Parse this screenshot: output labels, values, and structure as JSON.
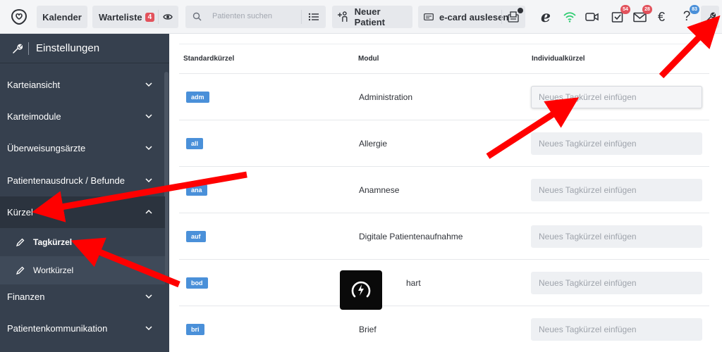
{
  "topbar": {
    "calendar_label": "Kalender",
    "waitlist_label": "Warteliste",
    "waitlist_count": "4",
    "search_placeholder": "Patienten suchen",
    "new_patient_label": "Neuer Patient",
    "ecard_label": "e-card auslesen",
    "tasks_badge": "54",
    "messages_badge": "28",
    "help_badge": "83"
  },
  "sidebar": {
    "title": "Einstellungen",
    "items": [
      {
        "label": "Karteiansicht"
      },
      {
        "label": "Karteimodule"
      },
      {
        "label": "Überweisungsärzte"
      },
      {
        "label": "Patientenausdruck / Befunde"
      },
      {
        "label": "Kürzel"
      },
      {
        "label": "Finanzen"
      },
      {
        "label": "Patientenkommunikation"
      }
    ],
    "subitems": [
      {
        "label": "Tagkürzel"
      },
      {
        "label": "Wortkürzel"
      }
    ]
  },
  "table": {
    "headers": {
      "standard": "Standardkürzel",
      "module": "Modul",
      "individual": "Individualkürzel"
    },
    "input_placeholder": "Neues Tagkürzel einfügen",
    "rows": [
      {
        "tag": "adm",
        "module": "Administration"
      },
      {
        "tag": "all",
        "module": "Allergie"
      },
      {
        "tag": "ana",
        "module": "Anamnese"
      },
      {
        "tag": "auf",
        "module": "Digitale Patientenaufnahme"
      },
      {
        "tag": "bod",
        "module": "hart"
      },
      {
        "tag": "bri",
        "module": "Brief"
      }
    ]
  },
  "colors": {
    "sidebar_bg": "#36404e",
    "tag_blue": "#4a90d9",
    "badge_red": "#e2525c",
    "arrow_red": "#ff0000",
    "wifi_green": "#2ecc71"
  },
  "icons": [
    "logo-icon",
    "eye-icon",
    "search-icon",
    "list-icon",
    "person-add-icon",
    "card-icon",
    "card-reader-icon",
    "e-health-icon",
    "wifi-icon",
    "video-icon",
    "tasks-icon",
    "mail-icon",
    "euro-icon",
    "help-icon",
    "wrench-icon",
    "chevron-down-icon",
    "chevron-up-icon",
    "pencil-icon",
    "loading-icon"
  ]
}
